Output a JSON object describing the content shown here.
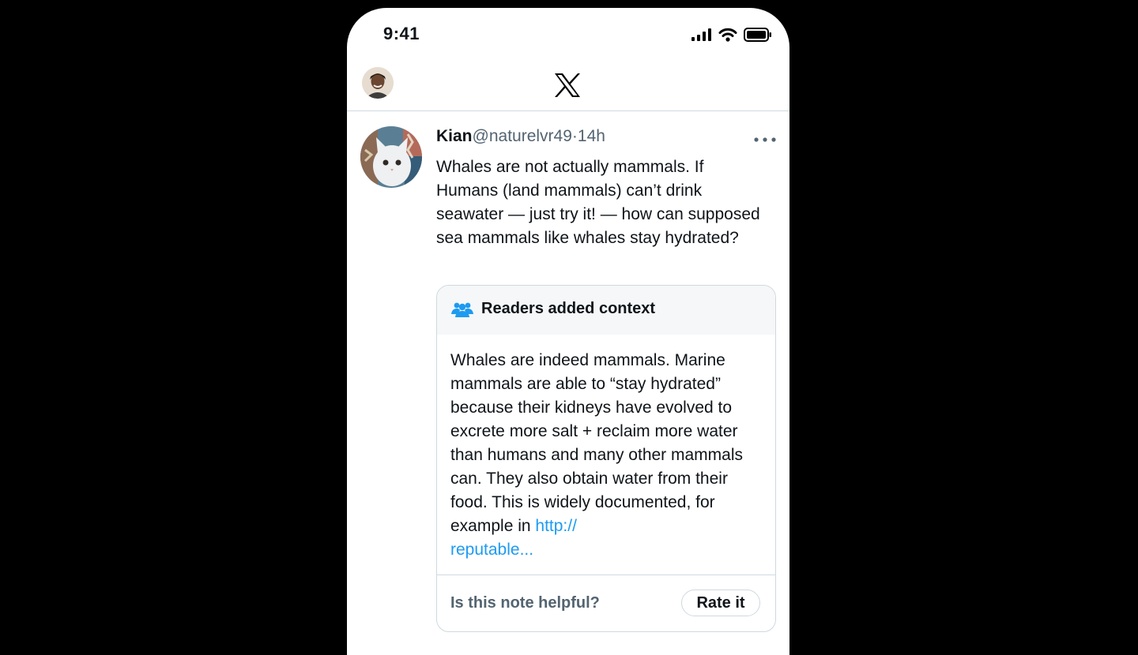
{
  "status_bar": {
    "time": "9:41"
  },
  "nav": {
    "logo_icon": "x-logo-icon"
  },
  "tweet": {
    "author_name": "Kian",
    "handle": "@naturelvr49",
    "separator": "·",
    "time": "14h",
    "text": "Whales are not actually mammals. If Humans (land mammals) can’t drink seawater — just try it! — how can supposed sea mammals like whales stay hydrated?"
  },
  "community_note": {
    "title": "Readers added context",
    "body": "Whales are indeed mammals. Marine mammals are able to “stay hydrated” because their kidneys have evolved to excrete more salt + reclaim more water than humans and many other mammals can. They also obtain water from their food. This is widely documented, for example in ",
    "link_text": "http://\nreputable...",
    "helpful_question": "Is this note helpful?",
    "rate_button": "Rate it"
  },
  "colors": {
    "link": "#1d9bf0",
    "secondary_text": "#536471",
    "divider": "#cfd9de"
  }
}
